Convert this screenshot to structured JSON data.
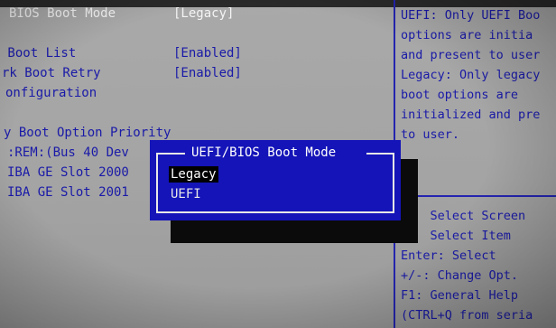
{
  "main": {
    "boot_mode_label": "BIOS Boot Mode",
    "boot_mode_value": "[Legacy]",
    "boot_list_label": " Boot List",
    "boot_list_value": "[Enabled]",
    "network_retry_label": "rk Boot Retry",
    "network_retry_value": "[Enabled]",
    "configuration_label": "onfiguration",
    "priority_label": "y Boot Option Priority",
    "boot_devices": [
      ":REM:(Bus 40 Dev",
      "IBA GE Slot 2000",
      "IBA GE Slot 2001"
    ]
  },
  "help": {
    "lines": [
      "UEFI: Only UEFI Boo",
      "options are initia",
      "and present to user",
      "Legacy: Only legacy",
      "boot options are",
      "initialized and pre",
      "to user."
    ]
  },
  "keys": {
    "lines": [
      "    Select Screen",
      "    Select Item",
      "Enter: Select",
      "+/-: Change Opt.",
      "F1: General Help",
      "(CTRL+Q from seria"
    ]
  },
  "popup": {
    "title": "UEFI/BIOS Boot Mode",
    "options": [
      "Legacy",
      "UEFI"
    ],
    "selected_index": 0
  }
}
